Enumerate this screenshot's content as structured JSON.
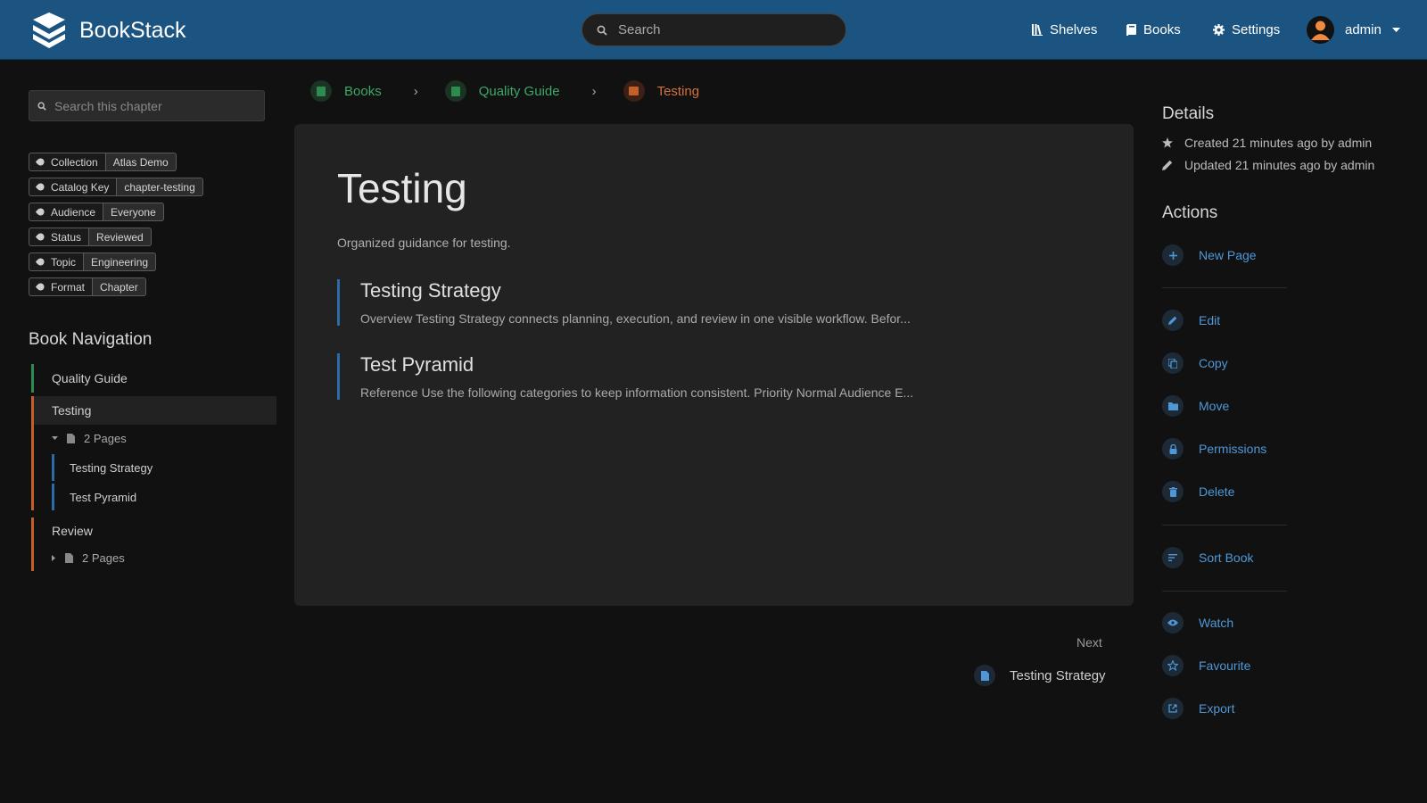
{
  "header": {
    "app_name": "BookStack",
    "search_placeholder": "Search",
    "nav": {
      "shelves": "Shelves",
      "books": "Books",
      "settings": "Settings"
    },
    "user": "admin"
  },
  "sidebar": {
    "search_placeholder": "Search this chapter",
    "tags": [
      {
        "name": "Collection",
        "value": "Atlas Demo"
      },
      {
        "name": "Catalog Key",
        "value": "chapter-testing"
      },
      {
        "name": "Audience",
        "value": "Everyone"
      },
      {
        "name": "Status",
        "value": "Reviewed"
      },
      {
        "name": "Topic",
        "value": "Engineering"
      },
      {
        "name": "Format",
        "value": "Chapter"
      }
    ],
    "book_nav_title": "Book Navigation",
    "book_nav": {
      "book": "Quality Guide",
      "chapter_current": "Testing",
      "chapter_current_pages": "2 Pages",
      "pages": [
        "Testing Strategy",
        "Test Pyramid"
      ],
      "chapter_other": "Review",
      "chapter_other_pages": "2 Pages"
    }
  },
  "breadcrumb": {
    "books": "Books",
    "book": "Quality Guide",
    "chapter": "Testing"
  },
  "main": {
    "title": "Testing",
    "description": "Organized guidance for testing.",
    "entries": [
      {
        "title": "Testing Strategy",
        "preview": "Overview Testing Strategy connects planning, execution, and review in one visible workflow. Befor..."
      },
      {
        "title": "Test Pyramid",
        "preview": "Reference Use the following categories to keep information consistent. Priority Normal Audience E..."
      }
    ],
    "next_label": "Next",
    "next_page": "Testing Strategy"
  },
  "details": {
    "title": "Details",
    "created": "Created 21 minutes ago by admin",
    "updated": "Updated 21 minutes ago by admin"
  },
  "actions": {
    "title": "Actions",
    "new_page": "New Page",
    "edit": "Edit",
    "copy": "Copy",
    "move": "Move",
    "permissions": "Permissions",
    "delete": "Delete",
    "sort_book": "Sort Book",
    "watch": "Watch",
    "favourite": "Favourite",
    "export": "Export"
  },
  "colors": {
    "header": "#1c5481",
    "book": "#2e8b4f",
    "chapter": "#c45f2a",
    "page": "#2b6ca6",
    "link": "#4e98d8"
  }
}
